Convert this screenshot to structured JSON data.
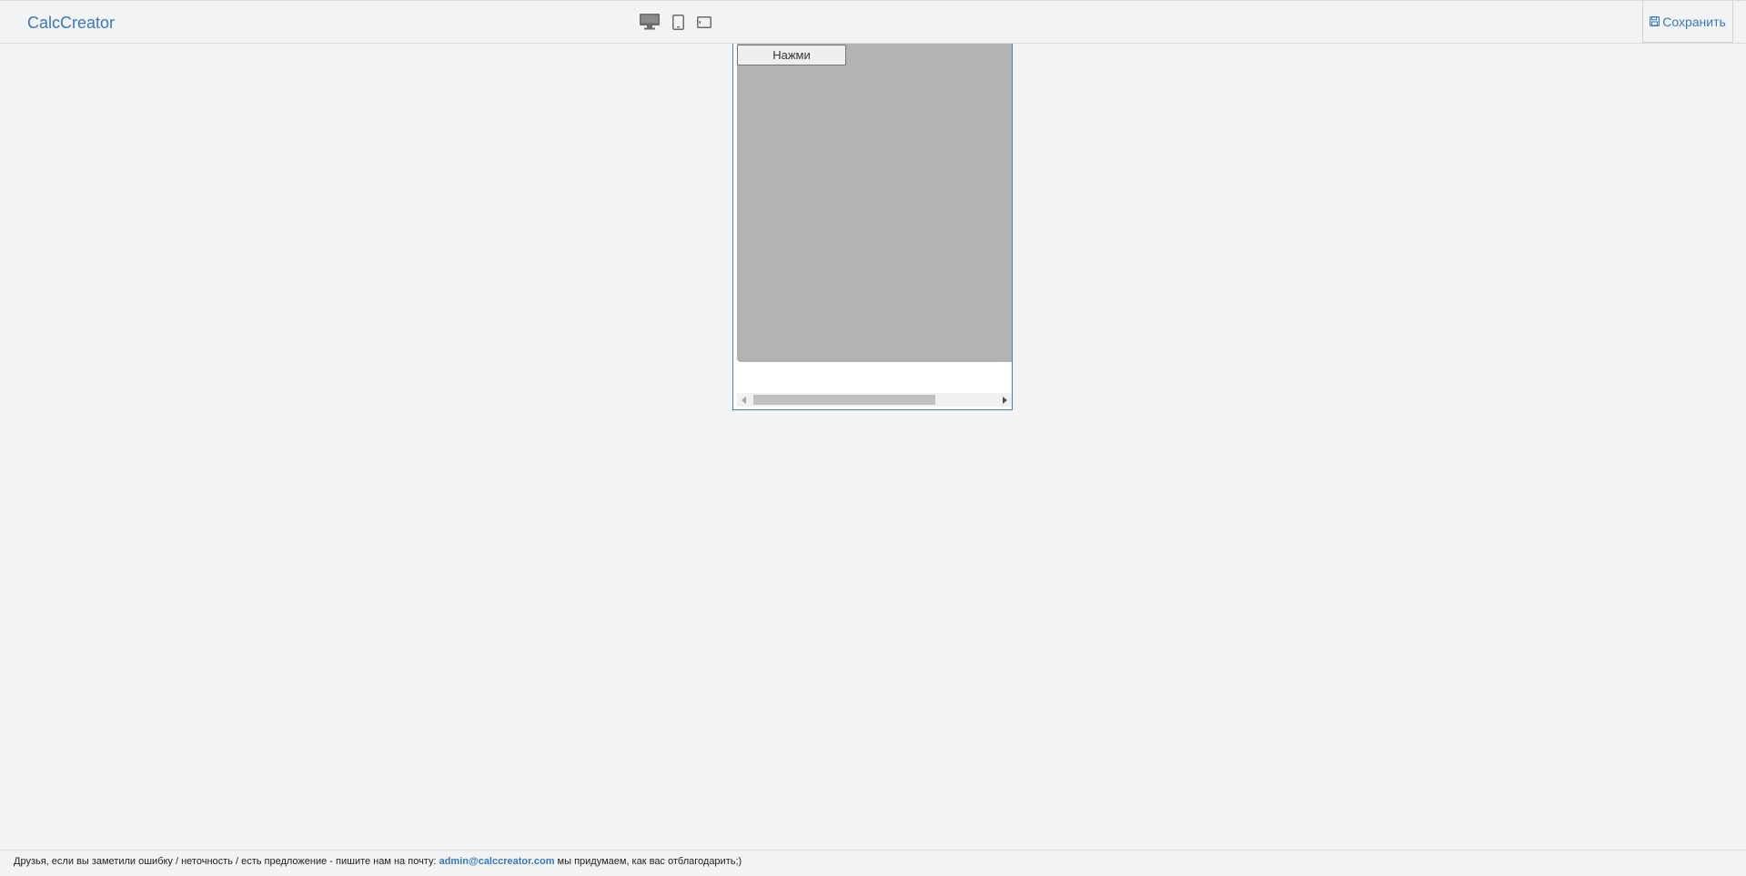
{
  "header": {
    "logo": "CalcCreator",
    "devices": [
      {
        "icon": "desktop-icon"
      },
      {
        "icon": "tablet-icon"
      },
      {
        "icon": "tablet-landscape-icon"
      }
    ],
    "save": {
      "icon": "floppy-disk-icon",
      "label": "Сохранить"
    }
  },
  "canvas": {
    "button_label": "Нажми",
    "background": "#b3b3b3"
  },
  "footer": {
    "text_before": "Друзья, если вы заметили ошибку / неточность / есть предложение - пишите нам на почту:",
    "email": "admin@calccreator.com",
    "text_after": "мы придумаем, как вас отблагодарить;)"
  },
  "colors": {
    "accent": "#3b78b5",
    "frame_border": "#4a7fb5",
    "page_bg": "#f2f3f5"
  }
}
